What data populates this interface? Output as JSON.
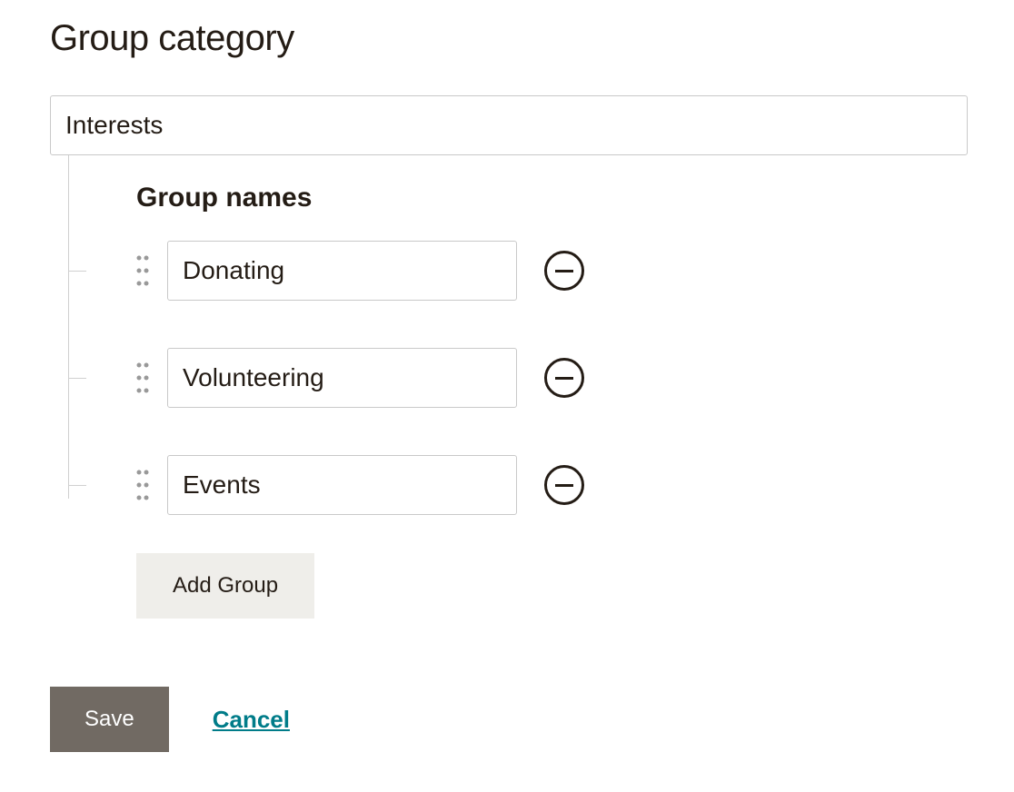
{
  "heading": "Group category",
  "category_value": "Interests",
  "group_names_heading": "Group names",
  "groups": [
    {
      "name": "Donating"
    },
    {
      "name": "Volunteering"
    },
    {
      "name": "Events"
    }
  ],
  "add_group_label": "Add Group",
  "save_label": "Save",
  "cancel_label": "Cancel"
}
